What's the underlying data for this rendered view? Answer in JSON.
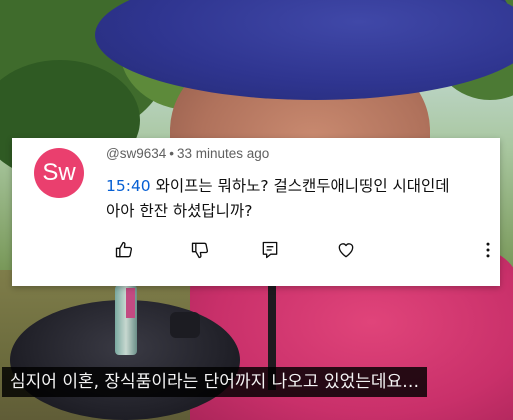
{
  "comment": {
    "avatar_initials": "Sw",
    "avatar_color": "#ea3f6e",
    "username": "@sw9634",
    "separator": "•",
    "posted_ago": "33 minutes ago",
    "timestamp_link": "15:40",
    "text_line1": " 와이프는 뭐하노? 걸스캔두애니띵인 시대인데",
    "text_line2": "아아 한잔 하셨답니까?",
    "actions": {
      "like_icon": "thumbs-up-icon",
      "dislike_icon": "thumbs-down-icon",
      "reply_icon": "reply-icon",
      "heart_icon": "heart-icon",
      "more_icon": "more-vert-icon"
    }
  },
  "subtitle": {
    "text": "심지어 이혼, 장식품이라는 단어까지 나오고 있었는데요…"
  }
}
